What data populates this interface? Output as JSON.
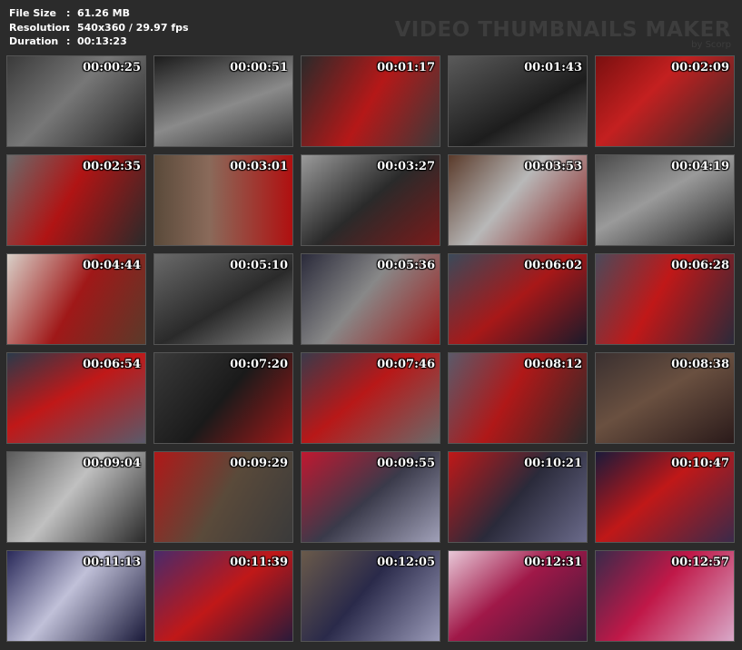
{
  "file_info": {
    "size_label": "File Size",
    "size_value": "61.26 MB",
    "resolution_label": "Resolution",
    "resolution_value": "540x360 / 29.97 fps",
    "duration_label": "Duration",
    "duration_value": "00:13:23"
  },
  "brand": {
    "title": "VIDEO THUMBNAILS MAKER",
    "subtitle": "by Scorp"
  },
  "thumbnails": [
    {
      "time": "00:00:25",
      "bg": "linear-gradient(135deg,#3a3a3a,#777 45%,#1f1f1f)"
    },
    {
      "time": "00:00:51",
      "bg": "linear-gradient(160deg,#1c1c1c,#8a8a8a 55%,#333)"
    },
    {
      "time": "00:01:17",
      "bg": "linear-gradient(120deg,#2a2a2a,#b51818 50%,#3a3a3a)"
    },
    {
      "time": "00:01:43",
      "bg": "linear-gradient(150deg,#5a5a5a,#1d1d1d 60%,#666)"
    },
    {
      "time": "00:02:09",
      "bg": "linear-gradient(135deg,#7a1010,#c42020 40%,#2a2a2a)"
    },
    {
      "time": "00:02:35",
      "bg": "linear-gradient(120deg,#6a6a6a,#b01414 45%,#2a2a2a)"
    },
    {
      "time": "00:03:01",
      "bg": "linear-gradient(90deg,#5a4a3a,#8a6a5a 40%,#b01010)"
    },
    {
      "time": "00:03:27",
      "bg": "linear-gradient(140deg,#9a9a9a,#2a2a2a 50%,#7a1a1a)"
    },
    {
      "time": "00:03:53",
      "bg": "linear-gradient(130deg,#5a3a2a,#b8b8b8 45%,#8a1818)"
    },
    {
      "time": "00:04:19",
      "bg": "linear-gradient(150deg,#4a4a4a,#9a9a9a 45%,#222)"
    },
    {
      "time": "00:04:44",
      "bg": "linear-gradient(120deg,#d8d0c8,#a01818 50%,#5a3a2a)"
    },
    {
      "time": "00:05:10",
      "bg": "linear-gradient(150deg,#6a6a6a,#2a2a2a 55%,#888)"
    },
    {
      "time": "00:05:36",
      "bg": "linear-gradient(130deg,#2a2a3a,#888 45%,#a01818)"
    },
    {
      "time": "00:06:02",
      "bg": "linear-gradient(140deg,#3a4a5a,#a81818 50%,#1a1a2a)"
    },
    {
      "time": "00:06:28",
      "bg": "linear-gradient(120deg,#4a4a5a,#c01818 45%,#2a2a3a)"
    },
    {
      "time": "00:06:54",
      "bg": "linear-gradient(150deg,#2a3a4a,#c01818 45%,#5a5a6a)"
    },
    {
      "time": "00:07:20",
      "bg": "linear-gradient(130deg,#3a3a3a,#1a1a1a 50%,#a01818)"
    },
    {
      "time": "00:07:46",
      "bg": "linear-gradient(140deg,#3a3a4a,#b81818 45%,#6a6a6a)"
    },
    {
      "time": "00:08:12",
      "bg": "linear-gradient(120deg,#5a5a6a,#b01818 45%,#2a2a2a)"
    },
    {
      "time": "00:08:38",
      "bg": "linear-gradient(150deg,#3a3030,#6a5040 45%,#2a1a1a)"
    },
    {
      "time": "00:09:04",
      "bg": "linear-gradient(130deg,#5a5a5a,#c0c0c0 45%,#2a2a2a)"
    },
    {
      "time": "00:09:29",
      "bg": "linear-gradient(120deg,#b01818,#5a4a3a 50%,#3a3a3a)"
    },
    {
      "time": "00:09:55",
      "bg": "linear-gradient(140deg,#c01830,#3a3a4a 50%,#a0a0b8)"
    },
    {
      "time": "00:10:21",
      "bg": "linear-gradient(130deg,#c01818,#2a2a3a 50%,#6a6a8a)"
    },
    {
      "time": "00:10:47",
      "bg": "linear-gradient(140deg,#1a1a3a,#c01818 45%,#3a2a4a)"
    },
    {
      "time": "00:11:13",
      "bg": "linear-gradient(130deg,#2a2a5a,#c0c0d8 45%,#1a1a3a)"
    },
    {
      "time": "00:11:39",
      "bg": "linear-gradient(140deg,#4a2a6a,#c01818 50%,#2a1a3a)"
    },
    {
      "time": "00:12:05",
      "bg": "linear-gradient(130deg,#6a5a4a,#2a2a4a 45%,#9a9ab8)"
    },
    {
      "time": "00:12:31",
      "bg": "linear-gradient(140deg,#e8c8d8,#a01848 45%,#3a1a3a)"
    },
    {
      "time": "00:12:57",
      "bg": "linear-gradient(130deg,#3a2a4a,#c01848 45%,#d8a8c8)"
    }
  ]
}
